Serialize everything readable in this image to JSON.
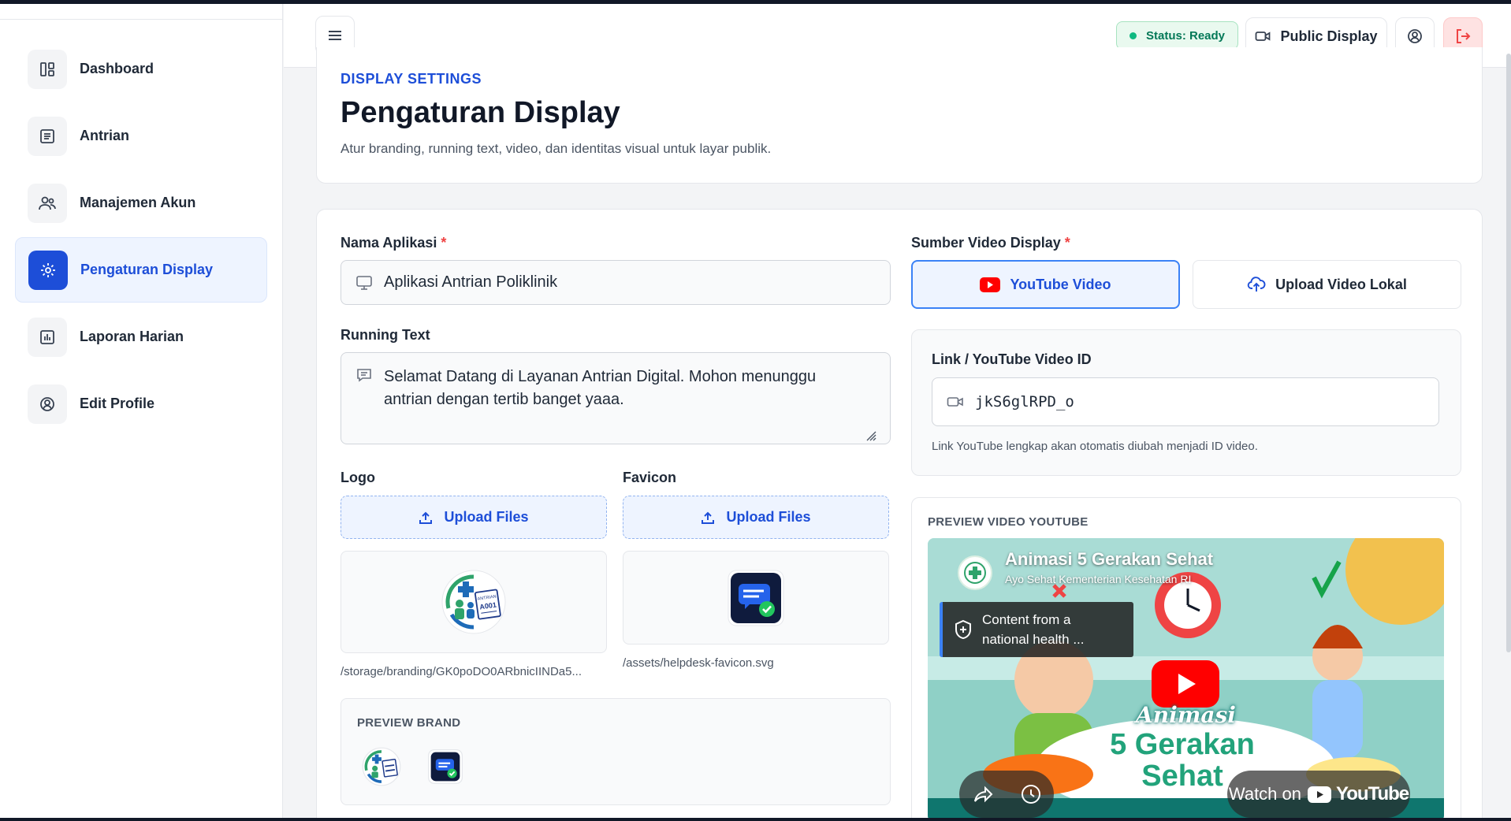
{
  "sidebar": {
    "items": [
      {
        "label": "Dashboard",
        "icon": "dashboard-icon",
        "active": false
      },
      {
        "label": "Antrian",
        "icon": "list-icon",
        "active": false
      },
      {
        "label": "Manajemen Akun",
        "icon": "users-icon",
        "active": false
      },
      {
        "label": "Pengaturan Display",
        "icon": "sun-icon",
        "active": true
      },
      {
        "label": "Laporan Harian",
        "icon": "bar-chart-icon",
        "active": false
      },
      {
        "label": "Edit Profile",
        "icon": "user-circle-icon",
        "active": false
      }
    ]
  },
  "header": {
    "status_label": "Status: Ready",
    "public_display_label": "Public Display"
  },
  "page": {
    "eyebrow": "DISPLAY SETTINGS",
    "title": "Pengaturan Display",
    "subtitle": "Atur branding, running text, video, dan identitas visual untuk layar publik."
  },
  "form": {
    "app_name_label": "Nama Aplikasi",
    "required_mark": "*",
    "app_name_value": "Aplikasi Antrian Poliklinik",
    "running_text_label": "Running Text",
    "running_text_value": "Selamat Datang di Layanan Antrian Digital. Mohon menunggu antrian dengan tertib banget yaaa.",
    "logo_label": "Logo",
    "favicon_label": "Favicon",
    "upload_label": "Upload Files",
    "logo_path": "/storage/branding/GK0poDO0ARbnicIINDa5...",
    "favicon_path": "/assets/helpdesk-favicon.svg",
    "preview_brand_label": "PREVIEW BRAND",
    "logo_badge_text": "ANTRIAN",
    "logo_badge_number": "A001",
    "video_source_label": "Sumber Video Display",
    "youtube_option": "YouTube Video",
    "upload_option": "Upload Video Lokal",
    "link_label": "Link / YouTube Video ID",
    "link_value": "jkS6glRPD_o",
    "link_hint": "Link YouTube lengkap akan otomatis diubah menjadi ID video.",
    "preview_video_label": "PREVIEW VIDEO YOUTUBE"
  },
  "video": {
    "title": "Animasi 5 Gerakan Sehat",
    "channel": "Ayo Sehat Kementerian Kesehatan RI",
    "notice": "Content from a national health ...",
    "animasi_word": "Animasi",
    "big_title": "5 Gerakan Sehat",
    "watch_on": "Watch on",
    "youtube_word": "YouTube"
  },
  "colors": {
    "accent": "#1d4ed8",
    "status_green": "#10b981",
    "danger": "#ef4444",
    "youtube_red": "#ff0000"
  }
}
